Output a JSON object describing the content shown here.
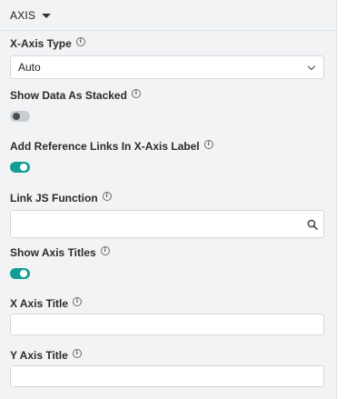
{
  "section": {
    "title": "AXIS"
  },
  "x_axis_type": {
    "label": "X-Axis Type",
    "value": "Auto"
  },
  "show_data_stacked": {
    "label": "Show Data As Stacked",
    "enabled": false
  },
  "reference_links": {
    "label": "Add Reference Links In X-Axis Label",
    "enabled": true
  },
  "link_js_function": {
    "label": "Link JS Function",
    "value": ""
  },
  "show_axis_titles": {
    "label": "Show Axis Titles",
    "enabled": true
  },
  "x_axis_title": {
    "label": "X Axis Title",
    "value": ""
  },
  "y_axis_title": {
    "label": "Y Axis Title",
    "value": ""
  },
  "icons": {
    "info": "info-icon",
    "dropdown": "chevron-down-icon",
    "search": "search-icon"
  },
  "colors": {
    "toggle_on": "#129e96",
    "toggle_off": "#c9cdd2"
  }
}
